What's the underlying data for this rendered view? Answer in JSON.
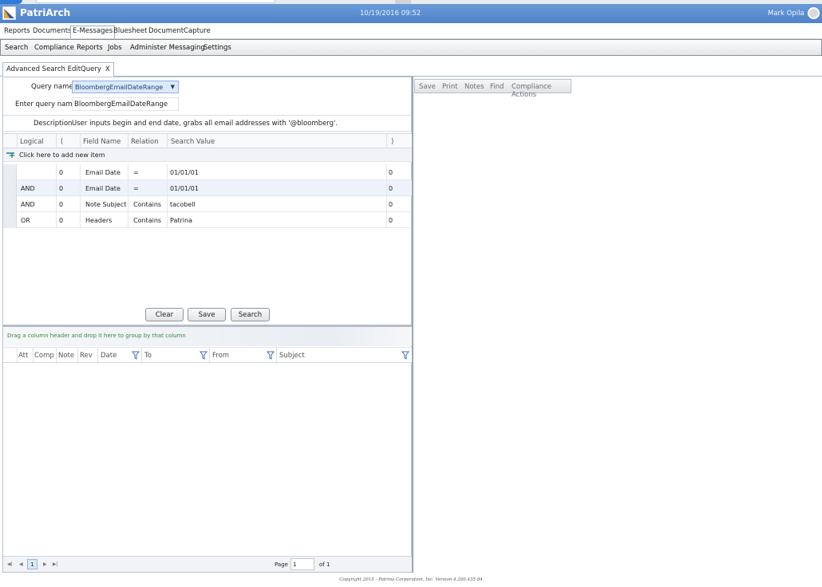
{
  "app": {
    "name": "PatriArch",
    "datetime": "10/19/2016 09:52",
    "user": "Mark Opila",
    "brand_color": "#4f83c8"
  },
  "main_nav": [
    "Reports",
    "Documents",
    "E-Messages",
    "Bluesheet",
    "DocumentCapture"
  ],
  "main_nav_active": "E-Messages",
  "sub_nav": [
    "Search",
    "Compliance",
    "Reports",
    "Jobs",
    "Administer Messaging",
    "Settings"
  ],
  "tab": {
    "label": "Advanced Search EditQuery",
    "close": "X"
  },
  "query": {
    "query_name_label": "Query name",
    "query_name_value": "BloombergEmailDateRange",
    "enter_name_label": "Enter query name",
    "enter_name_value": "BloombergEmailDateRange",
    "description_label": "Description",
    "description_value": "User inputs begin and end date, grabs all email addresses with '@bloomberg'."
  },
  "criteria_grid": {
    "columns": [
      "Logical",
      "(",
      "Field Name",
      "Relation",
      "Search Value",
      ")"
    ],
    "add_row_text": "Click here to add new item",
    "rows": [
      {
        "logical": "",
        "open": "0",
        "field": "Email Date",
        "relation": "=",
        "value": "01/01/01",
        "close": "0"
      },
      {
        "logical": "AND",
        "open": "0",
        "field": "Email Date",
        "relation": "=",
        "value": "01/01/01",
        "close": "0"
      },
      {
        "logical": "AND",
        "open": "0",
        "field": "Note Subject",
        "relation": "Contains",
        "value": "tacobell",
        "close": "0"
      },
      {
        "logical": "OR",
        "open": "0",
        "field": "Headers",
        "relation": "Contains",
        "value": "Patrina",
        "close": "0"
      }
    ]
  },
  "buttons": {
    "clear": "Clear",
    "save": "Save",
    "search": "Search"
  },
  "results": {
    "group_hint": "Drag a column header and drop it here to group by that column",
    "columns": [
      "Att",
      "Comp",
      "Note",
      "Rev",
      "Date",
      "To",
      "From",
      "Subject"
    ]
  },
  "pager": {
    "current_page": "1",
    "page_label": "Page",
    "page_value": "1",
    "of_label": "of 1"
  },
  "right_toolbar": [
    "Save",
    "Print",
    "Notes",
    "Find",
    "Compliance Actions"
  ],
  "footer": "Copyright 2015 - Patrina Corporation, Inc. Version 4.200.435.84"
}
